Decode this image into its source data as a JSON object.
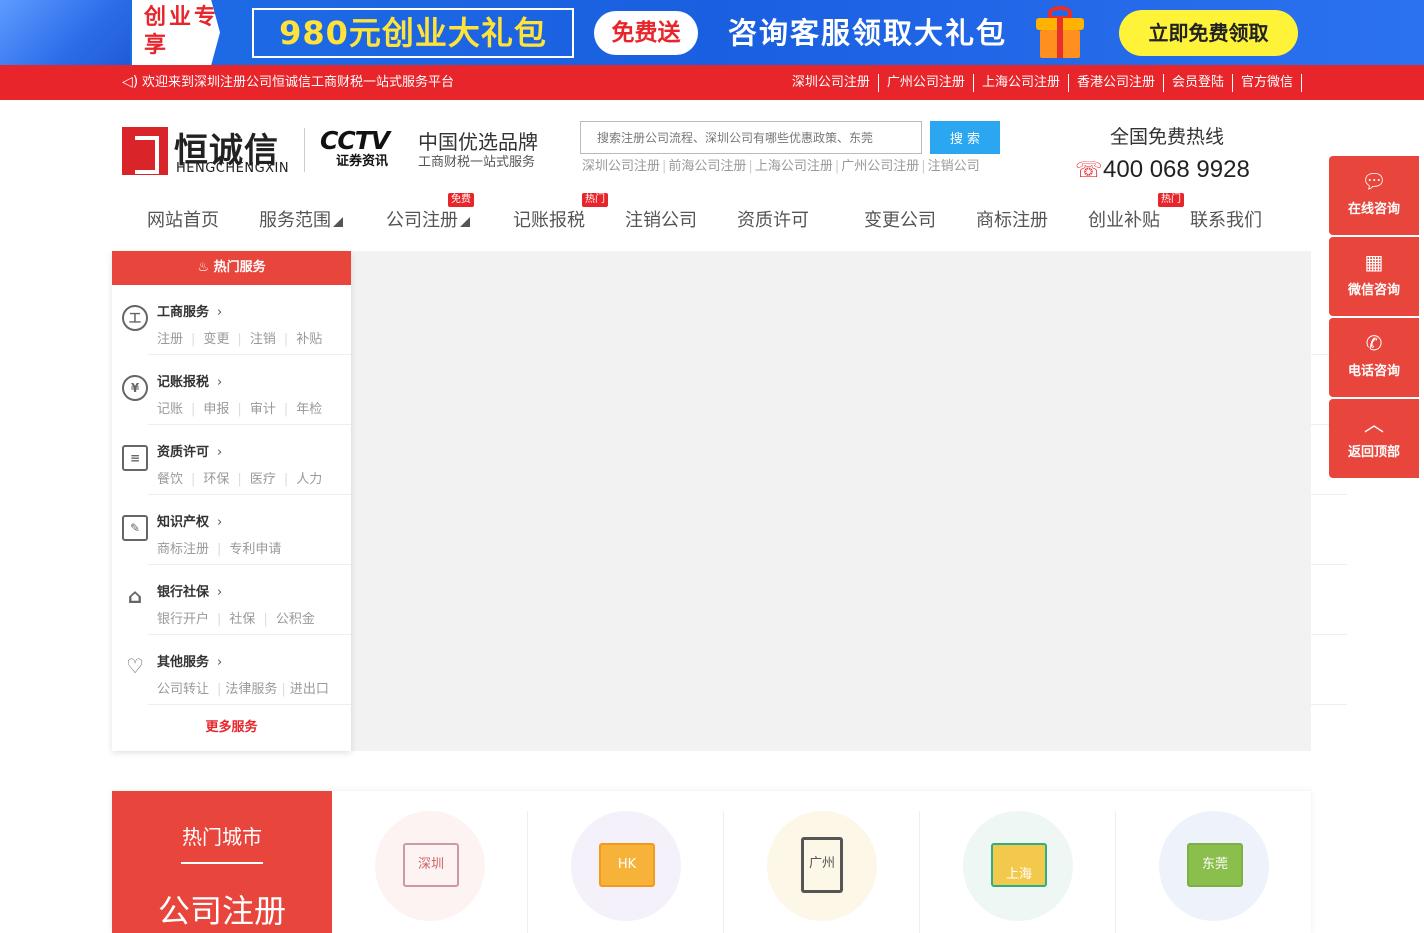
{
  "promo": {
    "tag": "创业专享",
    "box": "980元创业大礼包",
    "free": "免费送",
    "consult": "咨询客服领取大礼包",
    "cta": "立即免费领取"
  },
  "topbar": {
    "welcome": "欢迎来到深圳注册公司恒诚信工商财税一站式服务平台",
    "links": [
      "深圳公司注册",
      "广州公司注册",
      "上海公司注册",
      "香港公司注册",
      "会员登陆",
      "官方微信"
    ]
  },
  "header": {
    "logo_cn": "恒诚信",
    "logo_en": "HENGCHENGXIN",
    "cctv_big": "CCTV",
    "cctv_small": "证券资讯",
    "brand_title": "中国优选品牌",
    "brand_sub": "工商财税一站式服务",
    "search_placeholder": "搜索注册公司流程、深圳公司有哪些优惠政策、东莞",
    "search_button": "搜 索",
    "hot_words": [
      "深圳公司注册",
      "前海公司注册",
      "上海公司注册",
      "广州公司注册",
      "注销公司"
    ],
    "hotline_label": "全国免费热线",
    "hotline": "400 068 9928"
  },
  "nav": [
    {
      "label": "网站首页"
    },
    {
      "label": "服务范围"
    },
    {
      "label": "公司注册",
      "badge": "免费"
    },
    {
      "label": "记账报税",
      "badge": "热门"
    },
    {
      "label": "注销公司"
    },
    {
      "label": "资质许可"
    },
    {
      "label": "变更公司"
    },
    {
      "label": "商标注册"
    },
    {
      "label": "创业补贴",
      "badge": "热门"
    },
    {
      "label": "联系我们"
    }
  ],
  "sidebar": {
    "header": "热门服务",
    "items": [
      {
        "title": "工商服务",
        "icon": "business-icon",
        "subs": [
          "注册",
          "变更",
          "注销",
          "补贴"
        ]
      },
      {
        "title": "记账报税",
        "icon": "tax-icon",
        "subs": [
          "记账",
          "申报",
          "审计",
          "年检"
        ]
      },
      {
        "title": "资质许可",
        "icon": "license-icon",
        "subs": [
          "餐饮",
          "环保",
          "医疗",
          "人力"
        ]
      },
      {
        "title": "知识产权",
        "icon": "ip-icon",
        "subs": [
          "商标注册",
          "专利申请"
        ]
      },
      {
        "title": "银行社保",
        "icon": "bank-icon",
        "subs": [
          "银行开户",
          "社保",
          "公积金"
        ]
      },
      {
        "title": "其他服务",
        "icon": "other-icon",
        "subs": [
          "公司转让",
          "法律服务",
          "进出口"
        ]
      }
    ],
    "more": "更多服务"
  },
  "tools": [
    {
      "label": "在线咨询",
      "icon": "chat-icon"
    },
    {
      "label": "微信咨询",
      "icon": "qrcode-icon"
    },
    {
      "label": "电话咨询",
      "icon": "phone-icon"
    },
    {
      "label": "返回顶部",
      "icon": "arrow-up-icon"
    }
  ],
  "cities": {
    "heading": "热门城市",
    "subheading": "公司注册",
    "items": [
      {
        "label": "深圳",
        "bg": "#fdf3f2"
      },
      {
        "label": "HK",
        "bg": "#f5f1fb"
      },
      {
        "label": "广州",
        "bg": "#fdf7e8"
      },
      {
        "label": "上海",
        "bg": "#eef7f4"
      },
      {
        "label": "东莞",
        "bg": "#eef3fb"
      }
    ]
  },
  "colors": {
    "brand_red": "#e8252a",
    "accent_red": "#e8453c",
    "promo_blue": "#1f6fe8",
    "search_blue": "#2aa7f0"
  }
}
